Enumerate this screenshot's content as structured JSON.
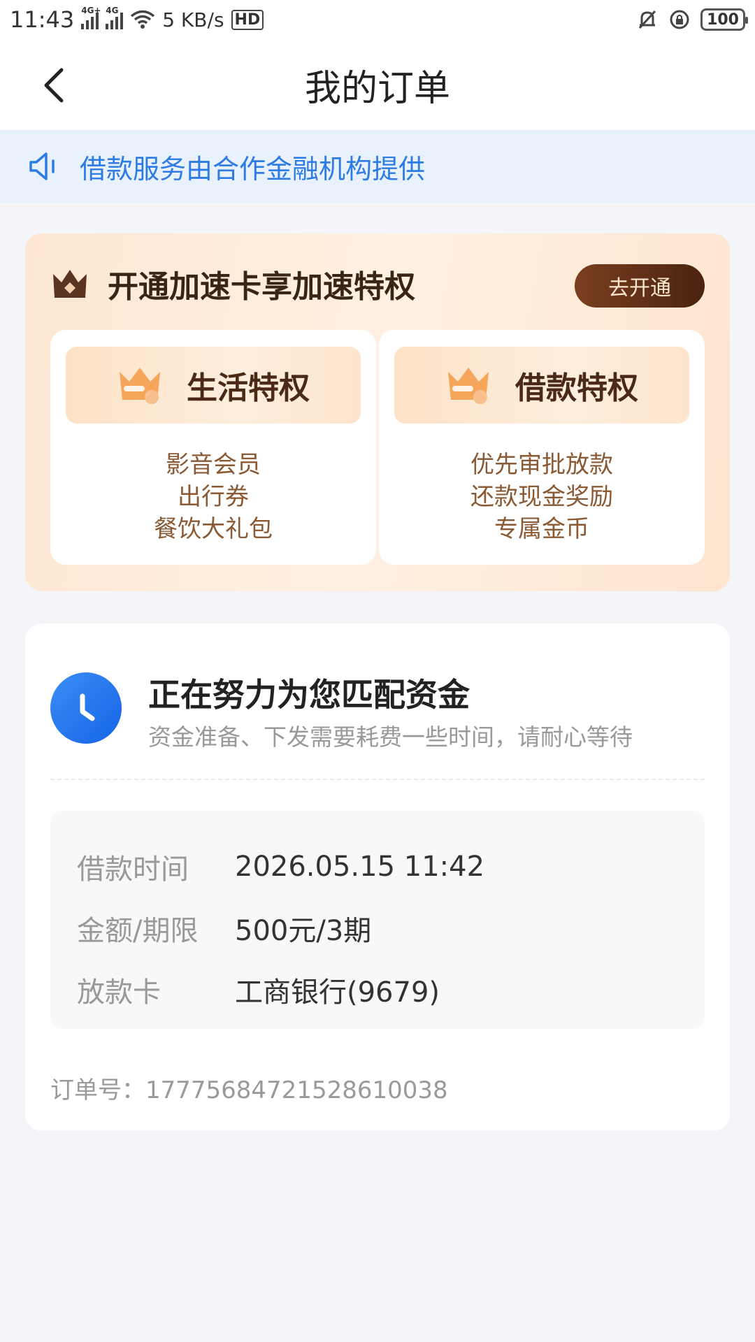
{
  "status_bar": {
    "time": "11:43",
    "sim1_tag": "4G+",
    "sim2_tag": "4G",
    "speed": "5 KB/s",
    "hd_label": "HD",
    "battery": "100"
  },
  "nav": {
    "title": "我的订单"
  },
  "notice": {
    "text": "借款服务由合作金融机构提供"
  },
  "promo": {
    "title": "开通加速卡享加速特权",
    "button_label": "去开通",
    "privileges": [
      {
        "name": "生活特权",
        "items": [
          "影音会员",
          "出行券",
          "餐饮大礼包"
        ]
      },
      {
        "name": "借款特权",
        "items": [
          "优先审批放款",
          "还款现金奖励",
          "专属金币"
        ]
      }
    ]
  },
  "status": {
    "title": "正在努力为您匹配资金",
    "subtitle": "资金准备、下发需要耗费一些时间，请耐心等待",
    "details": [
      {
        "label": "借款时间",
        "value": "2026.05.15 11:42"
      },
      {
        "label": "金额/期限",
        "value": "500元/3期"
      },
      {
        "label": "放款卡",
        "value": "工商银行(9679)"
      }
    ],
    "order_number": "订单号：17775684721528610038"
  },
  "colors": {
    "accent_blue": "#2d7be5",
    "promo_brown": "#4a2310",
    "privilege_text": "#8a5a35"
  }
}
